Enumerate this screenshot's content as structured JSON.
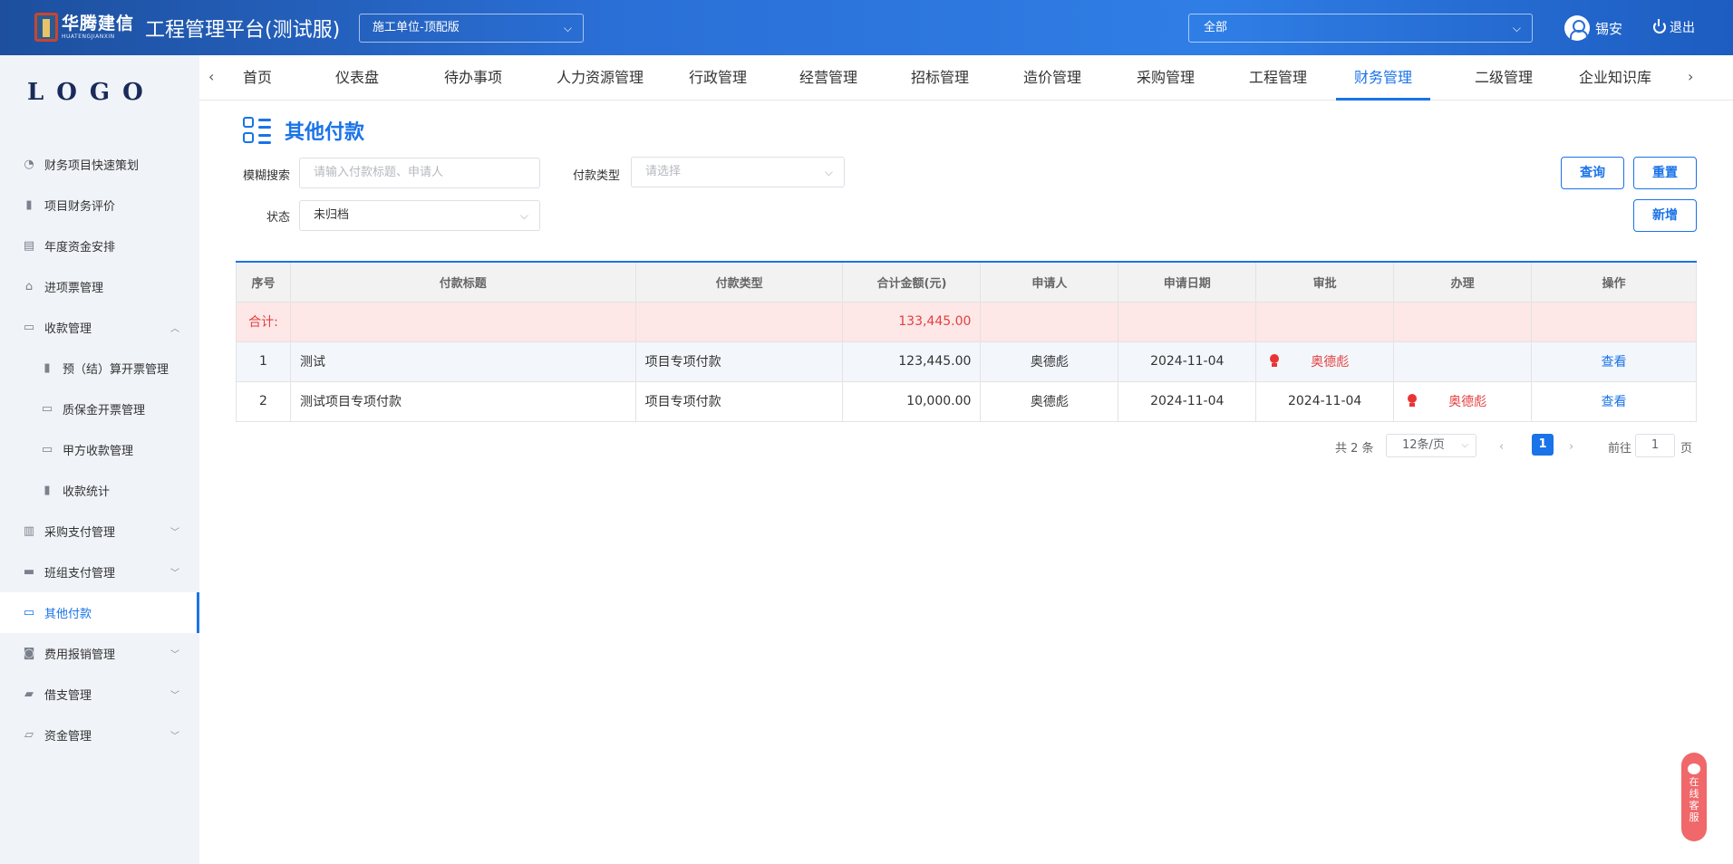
{
  "header": {
    "logo_text": "华腾建信",
    "logo_sub": "HUATENGJIANXIN",
    "title": "工程管理平台(测试服)",
    "unit_select": "施工单位-顶配版",
    "scope_select": "全部",
    "user_name": "锡安",
    "logout": "退出"
  },
  "sidebar": {
    "logo": "LOGO",
    "items": [
      {
        "label": "财务项目快速策划",
        "icon": "pie-chart-icon"
      },
      {
        "label": "项目财务评价",
        "icon": "bar-chart-icon"
      },
      {
        "label": "年度资金安排",
        "icon": "document-icon"
      },
      {
        "label": "进项票管理",
        "icon": "home-icon"
      },
      {
        "label": "收款管理",
        "icon": "monitor-icon",
        "expanded": true
      },
      {
        "label": "预（结）算开票管理",
        "icon": "bar-chart-icon"
      },
      {
        "label": "质保金开票管理",
        "icon": "monitor-icon"
      },
      {
        "label": "甲方收款管理",
        "icon": "monitor-icon"
      },
      {
        "label": "收款统计",
        "icon": "bar-chart-icon"
      },
      {
        "label": "采购支付管理",
        "icon": "books-icon"
      },
      {
        "label": "班组支付管理",
        "icon": "briefcase-icon"
      },
      {
        "label": "其他付款",
        "icon": "card-icon",
        "active": true
      },
      {
        "label": "费用报销管理",
        "icon": "camera-icon"
      },
      {
        "label": "借支管理",
        "icon": "ticket-icon"
      },
      {
        "label": "资金管理",
        "icon": "folder-icon"
      }
    ]
  },
  "nav": {
    "tabs": [
      "首页",
      "仪表盘",
      "待办事项",
      "人力资源管理",
      "行政管理",
      "经营管理",
      "招标管理",
      "造价管理",
      "采购管理",
      "工程管理",
      "财务管理",
      "二级管理",
      "企业知识库"
    ],
    "active": "财务管理"
  },
  "page": {
    "title": "其他付款",
    "filters": {
      "search_label": "模糊搜索",
      "search_placeholder": "请输入付款标题、申请人",
      "type_label": "付款类型",
      "type_placeholder": "请选择",
      "status_label": "状态",
      "status_value": "未归档"
    },
    "buttons": {
      "query": "查询",
      "reset": "重置",
      "add": "新增"
    }
  },
  "table": {
    "headers": [
      "序号",
      "付款标题",
      "付款类型",
      "合计金额(元)",
      "申请人",
      "申请日期",
      "审批",
      "办理",
      "操作"
    ],
    "summary": {
      "label": "合计:",
      "amount": "133,445.00"
    },
    "rows": [
      {
        "no": "1",
        "title": "测试",
        "type": "项目专项付款",
        "amount": "123,445.00",
        "applicant": "奥德彪",
        "date": "2024-11-04",
        "approve_date": "",
        "approve_person": "奥德彪",
        "handle_date": "",
        "handle_person": "",
        "action": "查看"
      },
      {
        "no": "2",
        "title": "测试项目专项付款",
        "type": "项目专项付款",
        "amount": "10,000.00",
        "applicant": "奥德彪",
        "date": "2024-11-04",
        "approve_date": "2024-11-04",
        "approve_person": "",
        "handle_date": "",
        "handle_person": "奥德彪",
        "action": "查看"
      }
    ]
  },
  "pagination": {
    "total": "共 2 条",
    "page_size": "12条/页",
    "current": "1",
    "goto_label": "前往",
    "goto_value": "1",
    "page_suffix": "页"
  },
  "service": {
    "label": "在线客服"
  },
  "colors": {
    "accent": "#1a73e8",
    "danger": "#e43f3f",
    "summary_bg": "#fde7e7"
  }
}
